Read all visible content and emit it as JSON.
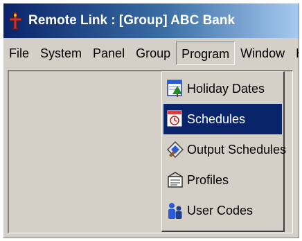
{
  "window": {
    "title": "Remote Link : [Group] ABC Bank"
  },
  "menubar": {
    "items": [
      "File",
      "System",
      "Panel",
      "Group",
      "Program",
      "Window",
      "Help"
    ],
    "open_item": "Program"
  },
  "program_menu": {
    "items": [
      {
        "label": "Holiday Dates",
        "icon": "calendar-tree-icon"
      },
      {
        "label": "Schedules",
        "icon": "schedule-clock-icon",
        "selected": true
      },
      {
        "label": "Output Schedules",
        "icon": "output-schedule-icon"
      },
      {
        "label": "Profiles",
        "icon": "profiles-icon"
      },
      {
        "label": "User Codes",
        "icon": "user-codes-icon"
      }
    ]
  },
  "colors": {
    "title_bar": "#0a246a",
    "menu_selection": "#0a246a",
    "face": "#d4d0c8"
  }
}
